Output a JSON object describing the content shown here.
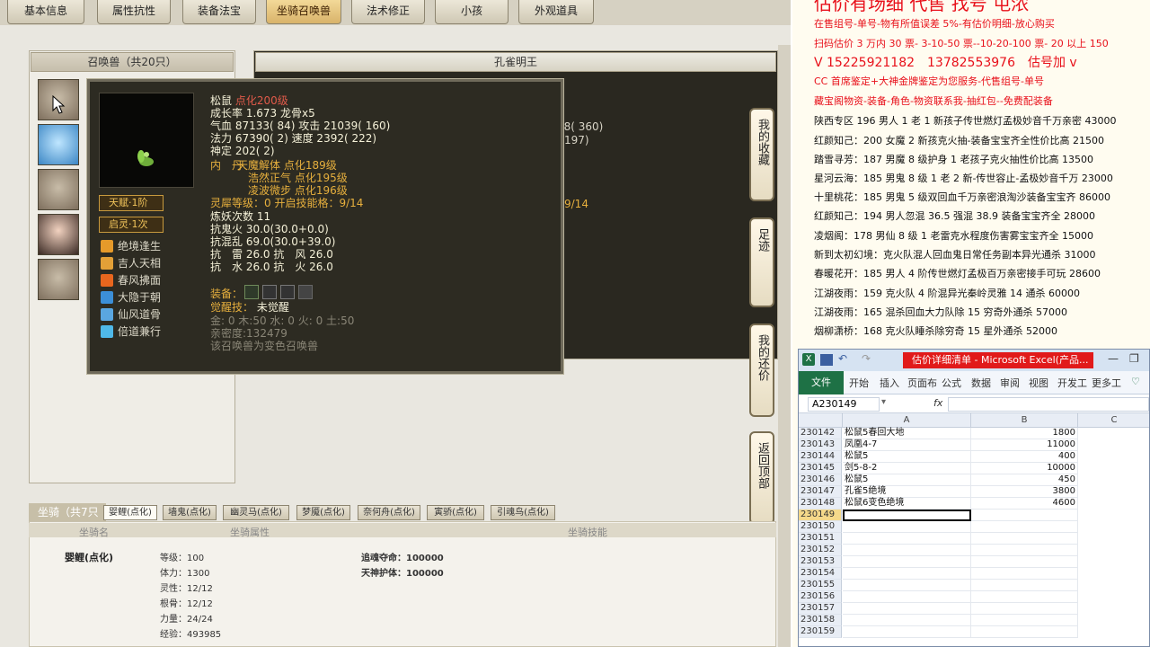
{
  "game": {
    "tabs": [
      "基本信息",
      "属性抗性",
      "装备法宝",
      "坐骑召唤兽",
      "法术修正",
      "小孩",
      "外观道具"
    ],
    "summon_panel_title": "召唤兽（共20只）",
    "right_panel_title": "孔雀明王",
    "behind_fragments": [
      "78( 360)",
      "197)",
      "9/14"
    ],
    "popup": {
      "name": "松鼠",
      "name_suffix": "点化200级",
      "growth": "成长率 1.673 龙骨x5",
      "hp": "气血 87133( 84) 攻击 21039( 160)",
      "mp": "法力 67390( 2) 速度 2392( 222)",
      "spirit": "神定 202( 2)",
      "inner_label": "内　丹",
      "inner1": "天魔解体 点化189级",
      "inner2": "浩然正气 点化195级",
      "inner3": "凌波微步 点化196级",
      "spirit_level": "灵犀等级：0 开启技能格：9/14",
      "refine": "炼妖次数 11",
      "res1": "抗鬼火 30.0(30.0+0.0)",
      "res2": "抗混乱 69.0(30.0+39.0)",
      "res3": "抗　雷 26.0 抗　风 26.0",
      "res4": "抗　水 26.0 抗　火 26.0",
      "equip_label": "装备：",
      "awaken_label": "觉醒技：",
      "awaken_value": "未觉醒",
      "elements": "金: 0 木:50 水: 0 火: 0 土:50",
      "intimacy": "亲密度:132479",
      "note": "该召唤兽为变色召唤兽",
      "talent_badge": "天赋·1阶",
      "spirit_badge": "启灵·1次",
      "skills": [
        "绝境逢生",
        "吉人天相",
        "春风拂面",
        "大隐于朝",
        "仙风道骨",
        "倍道兼行"
      ]
    },
    "side_buttons": [
      "我的收藏",
      "足迹",
      "我的还价",
      "返回顶部"
    ],
    "mount": {
      "section_label": "坐骑（共7只",
      "tabs": [
        "婴鲤(点化)",
        "墙鬼(点化)",
        "幽灵马(点化)",
        "梦魇(点化)",
        "奈何舟(点化)",
        "寅骄(点化)",
        "引魂鸟(点化)"
      ],
      "col_name": "坐骑名",
      "col_attr": "坐骑属性",
      "col_skill": "坐骑技能",
      "name": "婴鲤(点化)",
      "stats": [
        "等级：100",
        "体力：1300",
        "灵性：12/12",
        "根骨：12/12",
        "力量：24/24",
        "经验：493985"
      ],
      "skills": [
        "追魂夺命：100000",
        "天神护体：100000"
      ]
    }
  },
  "ads": {
    "title": "估价有场细 代售 找号 屯浓",
    "lines": [
      "在售组号-单号-物有所值误差 5%-有估价明细-放心购买",
      "扫码估价 3 万内 30 票- 3-10-50 票--10-20-100 票- 20 以上 150",
      "V 15225921182　13782553976　估号加 v",
      "CC 首席鉴定+大神金牌鉴定为您服务-代售组号-单号",
      "藏宝阁物资-装备-角色-物资联系我-抽红包--免费配装备",
      "陕西专区 196 男人 1 老 1 新孩子传世燃灯孟极妙音千万亲密 43000",
      "红颜知己：200 女魔 2 新孩克火抽-装备宝宝齐全性价比高 21500",
      "踏雪寻芳：187 男魔 8 级护身 1 老孩子克火抽性价比高 13500",
      "星河云海：185 男鬼 8 级 1 老 2 新-传世容止-孟极妙音千万 23000",
      "十里桃花：185 男鬼 5 级双回血千万亲密浪淘沙装备宝宝齐 86000",
      "红颜知己：194 男人忽混 36.5 强混 38.9 装备宝宝齐全 28000",
      "凌烟阁：178 男仙 8 级 1 老雷克水程度伤害雾宝宝齐全 15000",
      "新到太初幻境：克火队混人回血鬼日常任务副本异光通杀 31000",
      "春暖花开：185 男人 4 阶传世燃灯孟极百万亲密接手可玩 28600",
      "江湖夜雨：159 克火队 4 阶混异光秦岭灵雅 14 通杀 60000",
      "江湖夜雨：165 混杀回血大力队除 15 穷奇外通杀 57000",
      "烟柳潇桥：168 克火队睡杀除穷奇 15 星外通杀 52000"
    ],
    "colors": {
      "red": "#e8101a",
      "dark": "#111111"
    }
  },
  "excel": {
    "title": "估价详细清单 - Microsoft Excel(产品...",
    "ribbon": [
      "文件",
      "开始",
      "插入",
      "页面布",
      "公式",
      "数据",
      "审阅",
      "视图",
      "开发工",
      "更多工"
    ],
    "name_box": "A230149",
    "fx": "fx",
    "columns": [
      "A",
      "B",
      "C"
    ],
    "rows": [
      {
        "n": "230142",
        "a": "松鼠5春回大地",
        "b": "1800"
      },
      {
        "n": "230143",
        "a": "凤凰4-7",
        "b": "11000"
      },
      {
        "n": "230144",
        "a": "松鼠5",
        "b": "400"
      },
      {
        "n": "230145",
        "a": "剑5-8-2",
        "b": "10000"
      },
      {
        "n": "230146",
        "a": "松鼠5",
        "b": "450"
      },
      {
        "n": "230147",
        "a": "孔雀5绝境",
        "b": "3800"
      },
      {
        "n": "230148",
        "a": "松鼠6变色绝境",
        "b": "4600"
      },
      {
        "n": "230149",
        "a": "",
        "b": ""
      },
      {
        "n": "230150",
        "a": "",
        "b": ""
      },
      {
        "n": "230151",
        "a": "",
        "b": ""
      },
      {
        "n": "230152",
        "a": "",
        "b": ""
      },
      {
        "n": "230153",
        "a": "",
        "b": ""
      },
      {
        "n": "230154",
        "a": "",
        "b": ""
      },
      {
        "n": "230155",
        "a": "",
        "b": ""
      },
      {
        "n": "230156",
        "a": "",
        "b": ""
      },
      {
        "n": "230157",
        "a": "",
        "b": ""
      },
      {
        "n": "230158",
        "a": "",
        "b": ""
      },
      {
        "n": "230159",
        "a": "",
        "b": ""
      }
    ]
  }
}
